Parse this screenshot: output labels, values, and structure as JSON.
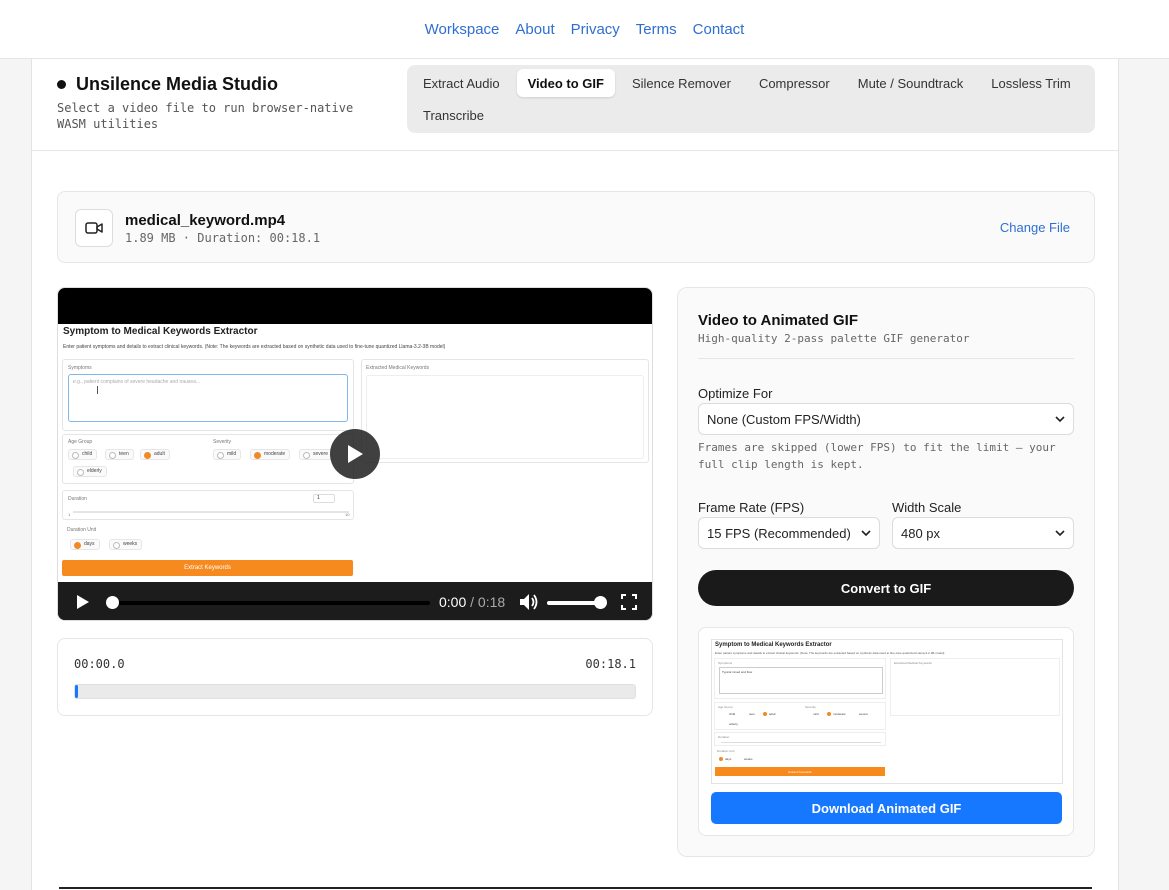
{
  "nav": {
    "links": [
      "Workspace",
      "About",
      "Privacy",
      "Terms",
      "Contact"
    ]
  },
  "header": {
    "title": "Unsilence Media Studio",
    "subtitle": "Select a video file to run browser-native WASM utilities"
  },
  "tabs": [
    {
      "label": "Extract Audio",
      "active": false
    },
    {
      "label": "Video to GIF",
      "active": true
    },
    {
      "label": "Silence Remover",
      "active": false
    },
    {
      "label": "Compressor",
      "active": false
    },
    {
      "label": "Mute / Soundtrack",
      "active": false
    },
    {
      "label": "Lossless Trim",
      "active": false
    },
    {
      "label": "Transcribe",
      "active": false
    }
  ],
  "file": {
    "name": "medical_keyword.mp4",
    "meta": "1.89 MB · Duration: 00:18.1",
    "change_label": "Change File",
    "icon": "video-camera-icon"
  },
  "video_frame": {
    "title": "Symptom to Medical Keywords Extractor",
    "description": "Enter patient symptoms and details to extract clinical keywords. (Note: The keywords are extracted based on synthetic data used to fine-tune quantized Llama-3.2-3B model)",
    "symptoms_label": "Symptoms",
    "symptoms_placeholder": "e.g., patient complains of severe headache and nausea...",
    "extracted_label": "Extracted Medical Keywords",
    "age_label": "Age Group",
    "age_options": [
      "child",
      "teen",
      "adult",
      "elderly"
    ],
    "age_selected": "adult",
    "severity_label": "Severity",
    "severity_options": [
      "mild",
      "moderate",
      "severe"
    ],
    "severity_selected": "moderate",
    "duration_label": "Duration",
    "duration_value": "1",
    "duration_min": "1",
    "duration_max": "10",
    "unit_label": "Duration Unit",
    "unit_options": [
      "days",
      "weeks"
    ],
    "unit_selected": "days",
    "button_label": "Extract Keywords"
  },
  "player": {
    "current_time": "0:00",
    "separator": "/",
    "duration": "0:18",
    "progress": 0.0,
    "volume": 1.0
  },
  "trim": {
    "start": "00:00.0",
    "end": "00:18.1"
  },
  "panel": {
    "title": "Video to Animated GIF",
    "subtitle": "High-quality 2-pass palette GIF generator",
    "optimize_label": "Optimize For",
    "optimize_value": "None (Custom FPS/Width)",
    "hint": "Frames are skipped (lower FPS) to fit the limit — your full clip length is kept.",
    "fps_label": "Frame Rate (FPS)",
    "fps_value": "15 FPS (Recommended)",
    "width_label": "Width Scale",
    "width_value": "480 px",
    "convert_label": "Convert to GIF",
    "download_label": "Download Animated GIF",
    "gif_preview": {
      "title": "Symptom to Medical Keywords Extractor",
      "description": "Enter patient symptoms and details to extract clinical keywords. (Note: The keywords are extracted based on synthetic data used to fine-tune quantized Llama-3.2-3B model)",
      "symptoms_label": "Symptoms",
      "symptoms_value": "Typical mixed and flow",
      "extracted_label": "Extracted Medical Keywords",
      "age_label": "Age Group",
      "age_options": [
        "child",
        "teen",
        "adult",
        "elderly"
      ],
      "severity_label": "Severity",
      "severity_options": [
        "mild",
        "moderate",
        "severe"
      ],
      "duration_label": "Duration",
      "unit_label": "Duration Unit",
      "unit_options": [
        "days",
        "weeks"
      ],
      "button_label": "Extract Keywords"
    }
  },
  "colors": {
    "link": "#2f6fd0",
    "primary_button": "#1677ff",
    "dark_button": "#1a1a1a",
    "accent_orange": "#f08a24"
  }
}
